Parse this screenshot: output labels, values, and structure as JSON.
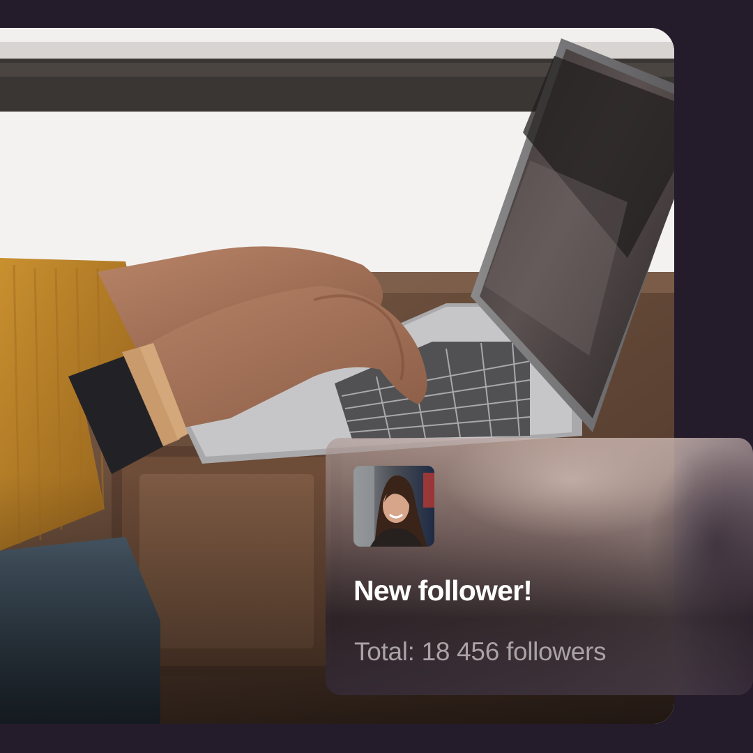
{
  "page": {
    "background_color": "#241b2b"
  },
  "photo": {
    "subject_icon": "laptop-typing-photo-icon"
  },
  "notification": {
    "title": "New follower!",
    "subtitle": "Total: 18 456 followers",
    "avatar_icon": "follower-avatar-icon",
    "title_color": "#ffffff",
    "subtitle_color": "#a9a3a6"
  }
}
